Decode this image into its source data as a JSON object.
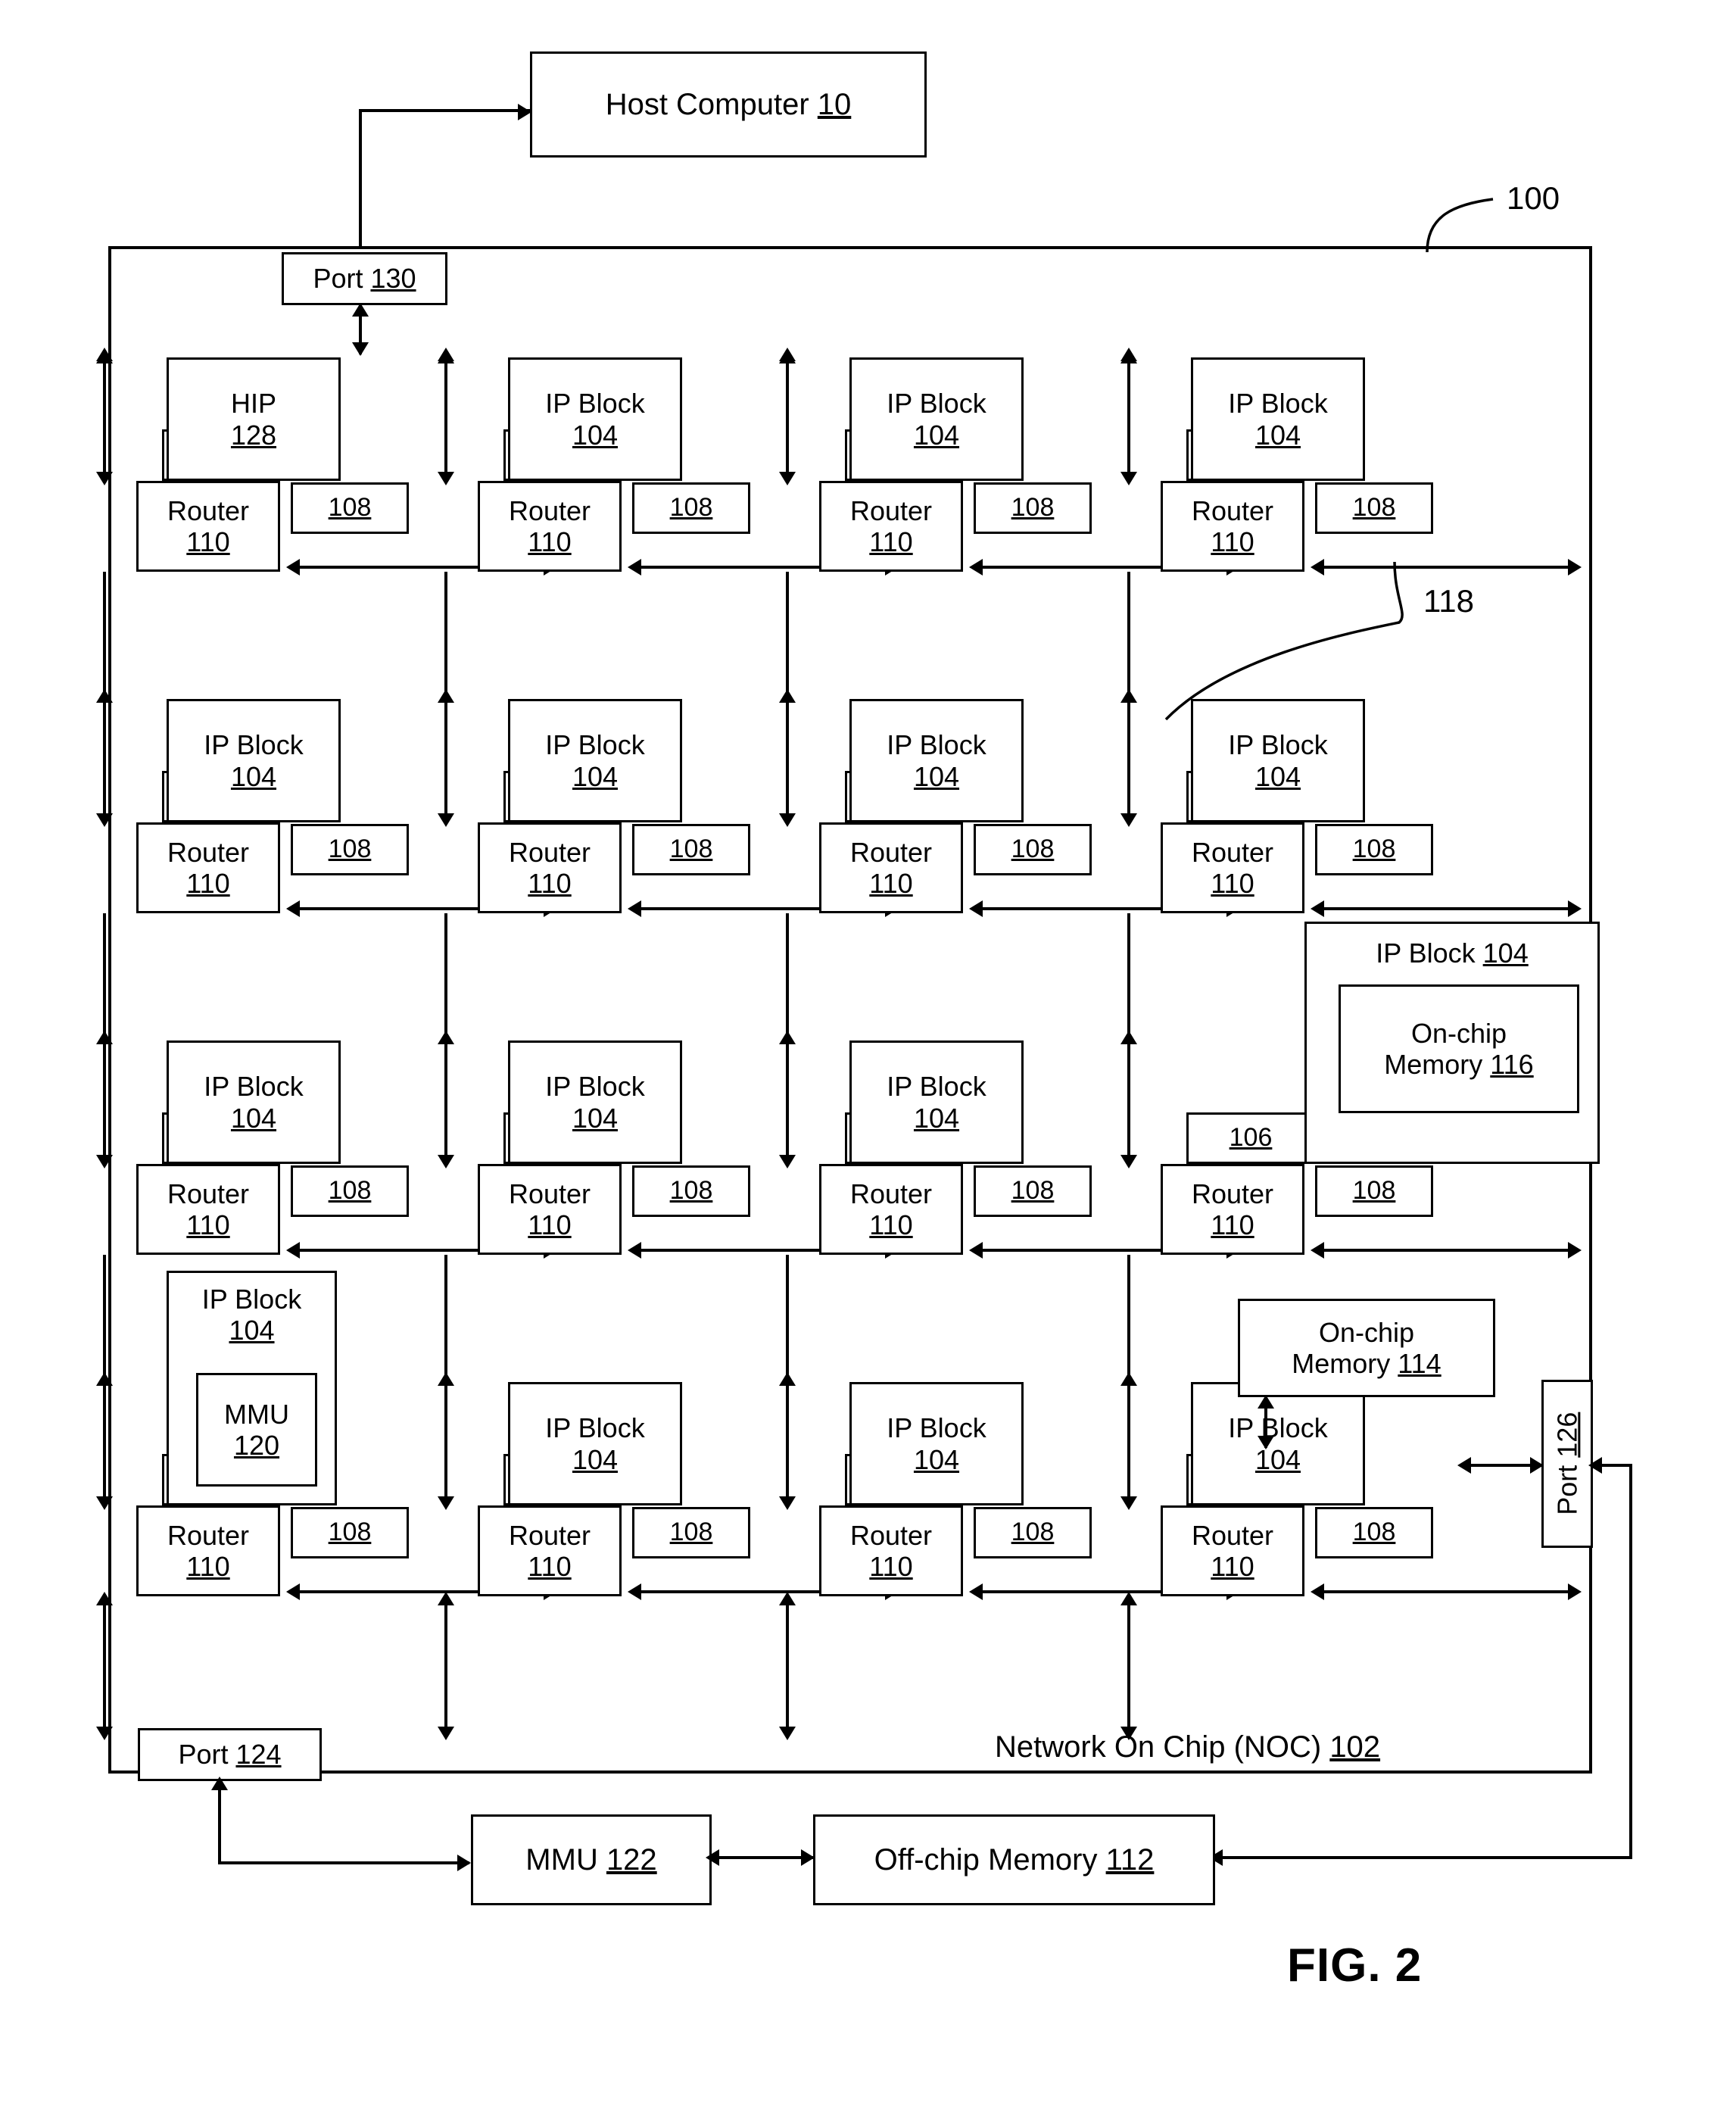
{
  "figure": {
    "label": "FIG. 2",
    "ref_100": "100",
    "ref_118": "118"
  },
  "host": {
    "label": "Host Computer ",
    "ref": "10"
  },
  "noc": {
    "title": "Network On Chip (NOC) ",
    "ref": "102"
  },
  "ports": {
    "p130": {
      "text": "Port ",
      "ref": "130"
    },
    "p124": {
      "text": "Port ",
      "ref": "124"
    },
    "p126": {
      "text": "Port ",
      "ref": "126"
    }
  },
  "external": {
    "mmu122": {
      "text": "MMU ",
      "ref": "122"
    },
    "offchip112": {
      "text": "Off-chip  Memory ",
      "ref": "112"
    }
  },
  "common": {
    "router_label": "Router",
    "router_ref": "110",
    "ref_106": "106",
    "ref_108": "108",
    "ip_label": "IP Block",
    "ip_ref": "104",
    "hip_label": "HIP",
    "hip_ref": "128"
  },
  "special": {
    "onchip116": {
      "line1": "On-chip",
      "line2": "Memory ",
      "ref": "116"
    },
    "onchip114": {
      "line1": "On-chip",
      "line2": "Memory ",
      "ref": "114"
    },
    "mmu120": {
      "label": "MMU",
      "ref": "120"
    },
    "ipblock_wide": {
      "label": "IP Block ",
      "ref": "104"
    }
  },
  "grid": {
    "rows": 4,
    "cols": 4,
    "nodes": [
      {
        "row": 0,
        "col": 0,
        "kind": "hip",
        "title": "HIP",
        "ref": "128"
      },
      {
        "row": 0,
        "col": 1,
        "kind": "ip",
        "title": "IP Block",
        "ref": "104"
      },
      {
        "row": 0,
        "col": 2,
        "kind": "ip",
        "title": "IP Block",
        "ref": "104"
      },
      {
        "row": 0,
        "col": 3,
        "kind": "ip",
        "title": "IP Block",
        "ref": "104"
      },
      {
        "row": 1,
        "col": 0,
        "kind": "ip",
        "title": "IP Block",
        "ref": "104"
      },
      {
        "row": 1,
        "col": 1,
        "kind": "ip",
        "title": "IP Block",
        "ref": "104"
      },
      {
        "row": 1,
        "col": 2,
        "kind": "ip",
        "title": "IP Block",
        "ref": "104"
      },
      {
        "row": 1,
        "col": 3,
        "kind": "ip",
        "title": "IP Block",
        "ref": "104"
      },
      {
        "row": 2,
        "col": 0,
        "kind": "ip",
        "title": "IP Block",
        "ref": "104"
      },
      {
        "row": 2,
        "col": 1,
        "kind": "ip",
        "title": "IP Block",
        "ref": "104"
      },
      {
        "row": 2,
        "col": 2,
        "kind": "ip",
        "title": "IP Block",
        "ref": "104"
      },
      {
        "row": 2,
        "col": 3,
        "kind": "memory",
        "title": "IP Block ",
        "ref": "104"
      },
      {
        "row": 3,
        "col": 0,
        "kind": "mmu",
        "title": "IP Block",
        "ref": "104"
      },
      {
        "row": 3,
        "col": 1,
        "kind": "ip",
        "title": "IP Block",
        "ref": "104"
      },
      {
        "row": 3,
        "col": 2,
        "kind": "ip",
        "title": "IP Block",
        "ref": "104"
      },
      {
        "row": 3,
        "col": 3,
        "kind": "ip",
        "title": "IP Block",
        "ref": "104"
      }
    ]
  }
}
